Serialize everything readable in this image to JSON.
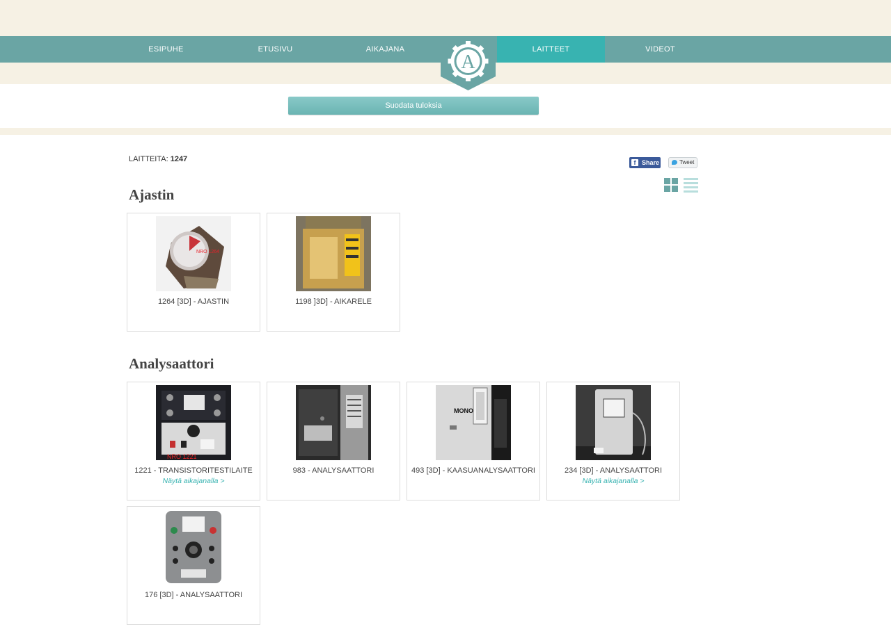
{
  "nav": {
    "items": [
      "ESIPUHE",
      "ETUSIVU",
      "AIKAJANA",
      "LAITTEET",
      "VIDEOT"
    ],
    "active": "LAITTEET"
  },
  "logo": {
    "letter": "A"
  },
  "filter": {
    "label": "Suodata tuloksia"
  },
  "count": {
    "label": "LAITTEITA:",
    "value": "1247"
  },
  "social": {
    "share": "Share",
    "share_icon": "f",
    "tweet": "Tweet"
  },
  "colors": {
    "nav": "#6aa5a4",
    "accent": "#38b3b1",
    "cream": "#f6f1e4"
  },
  "categories": [
    {
      "title": "Ajastin",
      "items": [
        {
          "title": "1264 [3D] - AJASTIN",
          "link": ""
        },
        {
          "title": "1198 ]3D] - AIKARELE",
          "link": ""
        }
      ]
    },
    {
      "title": "Analysaattori",
      "items": [
        {
          "title": "1221 - TRANSISTORITESTILAITE",
          "link": "Näytä aikajanalla >"
        },
        {
          "title": "983 - ANALYSAATTORI",
          "link": ""
        },
        {
          "title": "493 [3D] - KAASUANALYSAATTORI",
          "link": ""
        },
        {
          "title": "234 [3D] - ANALYSAATTORI",
          "link": "Näytä aikajanalla >"
        },
        {
          "title": "176 [3D] - ANALYSAATTORI",
          "link": ""
        }
      ]
    }
  ]
}
